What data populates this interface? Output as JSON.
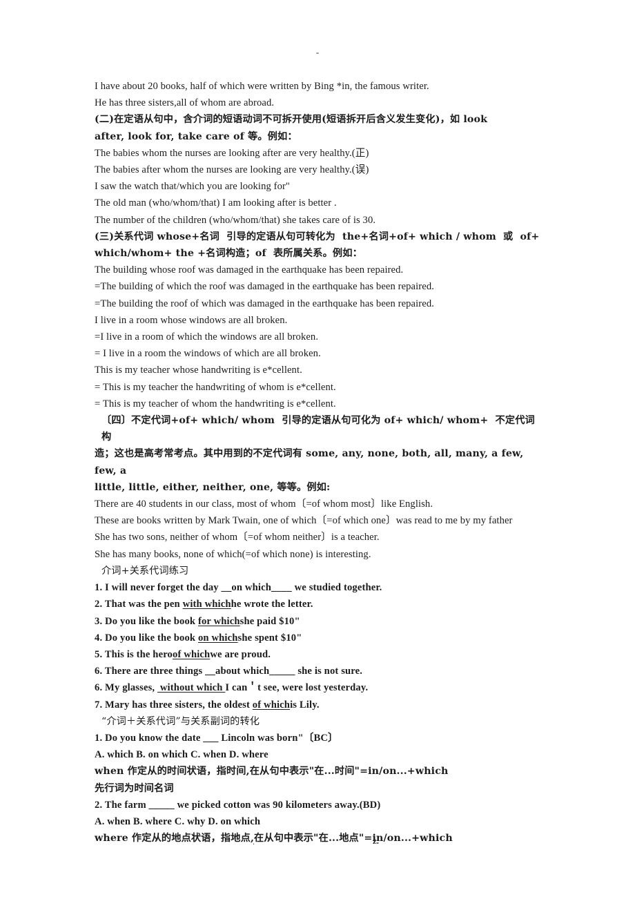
{
  "document": {
    "title": "介词+关系代词 定语从句讲义",
    "header_mark": "-",
    "footer": {
      "left_mark": ".",
      "right_mark": "z."
    },
    "lines": [
      {
        "id": "l1",
        "style": "plain",
        "text": "I have about 20 books, half of which were written by Bing *in, the famous writer."
      },
      {
        "id": "l2",
        "style": "plain",
        "text": "He has three sisters,all of whom are abroad."
      },
      {
        "id": "l3",
        "style": "bold-cn",
        "text": "(二)在定语从句中，含介词的短语动词不可拆开使用(短语拆开后含义发生变化)，如 look"
      },
      {
        "id": "l4",
        "style": "bold-cn",
        "text": "after, look for, take care of 等。例如："
      },
      {
        "id": "l5",
        "style": "plain",
        "text": "The babies whom the nurses are looking after are very healthy.(正)"
      },
      {
        "id": "l6",
        "style": "plain",
        "text": "The babies after whom the nurses are looking are very healthy.(误)"
      },
      {
        "id": "l7",
        "style": "plain",
        "text": "I saw the watch that/which you are looking for\""
      },
      {
        "id": "l8",
        "style": "plain",
        "text": "The old man (who/whom/that) I am looking after is better ."
      },
      {
        "id": "l9",
        "style": "plain",
        "text": "The number of the children (who/whom/that) she takes care of is 30."
      },
      {
        "id": "l10",
        "style": "bold-cn",
        "text": "(三)关系代词 whose+名词  引导的定语从句可转化为  the+名词+of+ which / whom  或  of+"
      },
      {
        "id": "l11",
        "style": "bold-cn",
        "text": "which/whom+ the +名词构造；of  表所属关系。例如："
      },
      {
        "id": "l12",
        "style": "plain",
        "text": "The building whose roof was damaged in the earthquake has been repaired."
      },
      {
        "id": "l13",
        "style": "plain",
        "text": "=The building of which the roof was damaged in the earthquake has been repaired."
      },
      {
        "id": "l14",
        "style": "plain",
        "text": "=The building the roof of which was damaged in the earthquake has been repaired."
      },
      {
        "id": "l15",
        "style": "plain",
        "text": "I live in a room whose windows are all broken."
      },
      {
        "id": "l16",
        "style": "plain",
        "text": "=I live in a room of which the windows are all broken."
      },
      {
        "id": "l17",
        "style": "plain",
        "text": "= I live in a room the windows of which are all broken."
      },
      {
        "id": "l18",
        "style": "plain",
        "text": "This is my teacher whose handwriting is e*cellent."
      },
      {
        "id": "l19",
        "style": "plain",
        "text": "= This is my teacher the handwriting of whom is e*cellent."
      },
      {
        "id": "l20",
        "style": "plain",
        "text": "= This is my teacher of whom the handwriting is e*cellent."
      },
      {
        "id": "l21",
        "style": "bold-cn-in",
        "text": "〔四〕不定代词+of+ which/ whom  引导的定语从句可化为 of+ which/ whom+  不定代词  构"
      },
      {
        "id": "l22",
        "style": "bold-cn",
        "text": "造；这也是高考常考点。其中用到的不定代词有 some, any, none, both, all, many, a few, few, a"
      },
      {
        "id": "l23",
        "style": "bold-cn",
        "text": "little, little, either, neither, one, 等等。例如:"
      },
      {
        "id": "l24",
        "style": "plain",
        "text": "There are 40 students in our class, most of whom〔=of whom most〕like English."
      },
      {
        "id": "l25",
        "style": "plain",
        "text": "These are books written by Mark Twain, one of which〔=of which one〕was read to me by my father"
      },
      {
        "id": "l26",
        "style": "plain",
        "text": "She has two sons, neither of whom〔=of whom neither〕is a teacher."
      },
      {
        "id": "l27",
        "style": "plain",
        "text": "She has many books, none of which(=of which none) is interesting."
      },
      {
        "id": "l28",
        "style": "cn-indent",
        "text": "介词+关系代词练习"
      },
      {
        "id": "l29",
        "style": "bold-q",
        "segments": [
          {
            "t": "1. I will never forget the day ",
            "u": false
          },
          {
            "t": "__on which____",
            "u": false
          },
          {
            "t": " we studied together.",
            "u": false
          }
        ]
      },
      {
        "id": "l30",
        "style": "bold-q",
        "segments": [
          {
            "t": "2. That was the pen ",
            "u": false
          },
          {
            "t": "with which",
            "u": true
          },
          {
            "t": "he wrote the letter.",
            "u": false
          }
        ]
      },
      {
        "id": "l31",
        "style": "bold-q",
        "segments": [
          {
            "t": "3. Do you like the book ",
            "u": false
          },
          {
            "t": "for which",
            "u": true
          },
          {
            "t": "she paid $10\"",
            "u": false
          }
        ]
      },
      {
        "id": "l32",
        "style": "bold-q",
        "segments": [
          {
            "t": "4. Do you like the book ",
            "u": false
          },
          {
            "t": "on which",
            "u": true
          },
          {
            "t": "she spent $10\"",
            "u": false
          }
        ]
      },
      {
        "id": "l33",
        "style": "bold-q",
        "segments": [
          {
            "t": "5. This is the hero",
            "u": false
          },
          {
            "t": "of which",
            "u": true
          },
          {
            "t": "we are proud.",
            "u": false
          }
        ]
      },
      {
        "id": "l34",
        "style": "bold-q",
        "segments": [
          {
            "t": "6. There are three things ",
            "u": false
          },
          {
            "t": "__about which_____",
            "u": false
          },
          {
            "t": " she is not sure.",
            "u": false
          }
        ]
      },
      {
        "id": "l35",
        "style": "bold-q",
        "segments": [
          {
            "t": "6. My glasses, ",
            "u": false
          },
          {
            "t": " without which ",
            "u": true
          },
          {
            "t": "I can＇t see, were lost yesterday.",
            "u": false
          }
        ]
      },
      {
        "id": "l36",
        "style": "bold-q",
        "segments": [
          {
            "t": "7. Mary has three sisters, the oldest ",
            "u": false
          },
          {
            "t": "of which",
            "u": true
          },
          {
            "t": "is Lily.",
            "u": false
          }
        ]
      },
      {
        "id": "l37",
        "style": "cn-indent",
        "text": "“介词＋关系代词”与关系副词的转化"
      },
      {
        "id": "l38",
        "style": "bold-q",
        "text": "1. Do you know the date ___ Lincoln was born\"〔BC〕"
      },
      {
        "id": "l39",
        "style": "bold-q",
        "text": "A. which B. on which C. when D. where"
      },
      {
        "id": "l40",
        "style": "bold-cn",
        "text": "when 作定从的时间状语，指时间,在从句中表示\"在...时间\"=in/on...+which"
      },
      {
        "id": "l41",
        "style": "bold-cn",
        "text": "先行词为时间名词"
      },
      {
        "id": "l42",
        "style": "bold-q",
        "text": "2. The farm _____ we picked cotton was 90 kilometers away.(BD)"
      },
      {
        "id": "l43",
        "style": "bold-q",
        "text": "A. when B. where C. why D. on which"
      },
      {
        "id": "l44",
        "style": "bold-cn",
        "text": "where 作定从的地点状语，指地点,在从句中表示\"在...地点\"=in/on...+which"
      }
    ]
  }
}
